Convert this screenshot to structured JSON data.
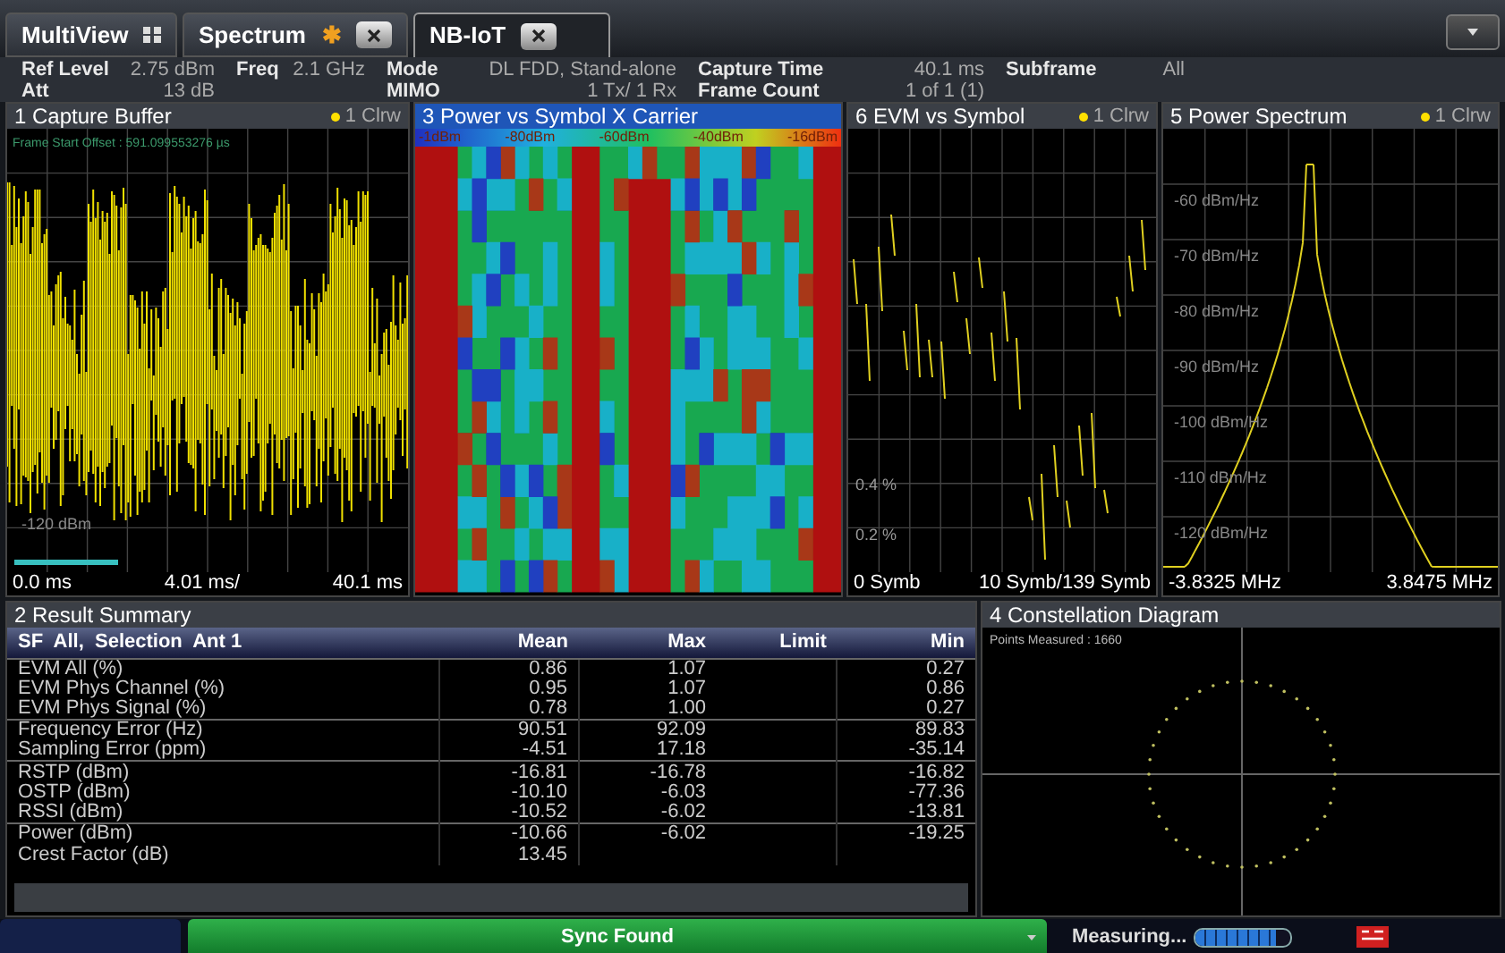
{
  "tabs": [
    {
      "label": "MultiView",
      "kind": "overview",
      "selected": false
    },
    {
      "label": "Spectrum",
      "kind": "closable",
      "selected": false,
      "modified": true,
      "mark": "✱"
    },
    {
      "label": "NB-IoT",
      "kind": "closable",
      "selected": true
    }
  ],
  "settings": [
    [
      {
        "label": "Ref Level",
        "value": "2.75 dBm"
      },
      {
        "label": "Att",
        "value": "13 dB"
      }
    ],
    [
      {
        "label": "Freq",
        "value": "2.1 GHz"
      }
    ],
    [
      {
        "label": "Mode",
        "value": "DL FDD, Stand-alone"
      },
      {
        "label": "MIMO",
        "value": "1 Tx/ 1 Rx"
      }
    ],
    [
      {
        "label": "Capture Time",
        "value": "40.1 ms"
      },
      {
        "label": "Frame Count",
        "value": "1 of 1 (1)"
      }
    ],
    [
      {
        "label": "Subframe",
        "value": "All"
      }
    ]
  ],
  "panels": [
    {
      "kind": "capture",
      "title": "1 Capture Buffer",
      "trace": "1 Clrw",
      "selected": false,
      "note": "Frame Start Offset : 591.099553276 µs",
      "y_labels": [
        "-120 dBm"
      ],
      "x_labels": [
        "0.0 ms",
        "4.01 ms/",
        "40.1 ms"
      ]
    },
    {
      "kind": "heatmap",
      "title": "3 Power vs Symbol X Carrier",
      "selected": true,
      "legend": [
        "-1dBm",
        "-80dBm",
        "-60dBm",
        "-40dBm",
        "-16dBm"
      ]
    },
    {
      "kind": "evm",
      "title": "6 EVM vs Symbol",
      "trace": "1 Clrw",
      "selected": false,
      "y_labels": [
        "0.4 %",
        "0.2 %"
      ],
      "x_labels": [
        "0 Symb",
        "10 Symb/139 Symb"
      ]
    },
    {
      "kind": "spectrum",
      "title": "5 Power Spectrum",
      "trace": "1 Clrw",
      "selected": false,
      "y_labels": [
        "-60 dBm/Hz",
        "-70 dBm/Hz",
        "-80 dBm/Hz",
        "-90 dBm/Hz",
        "-100 dBm/Hz",
        "-110 dBm/Hz",
        "-120 dBm/Hz"
      ],
      "x_labels": [
        "-3.8325 MHz",
        "3.8475 MHz"
      ]
    }
  ],
  "result_summary": {
    "title": "2 Result Summary",
    "columns": [
      "SF  All,  Selection  Ant 1",
      "Mean",
      "Max",
      "Limit",
      "Min"
    ],
    "groups": [
      [
        {
          "label": "EVM All (%)",
          "mean": "0.86",
          "max": "1.07",
          "min": "0.27"
        },
        {
          "label": "EVM Phys Channel (%)",
          "mean": "0.95",
          "max": "1.07",
          "min": "0.86"
        },
        {
          "label": "EVM Phys Signal (%)",
          "mean": "0.78",
          "max": "1.00",
          "min": "0.27"
        }
      ],
      [
        {
          "label": "Frequency Error (Hz)",
          "mean": "90.51",
          "max": "92.09",
          "min": "89.83"
        },
        {
          "label": "Sampling Error (ppm)",
          "mean": "-4.51",
          "max": "17.18",
          "min": "-35.14"
        }
      ],
      [
        {
          "label": "RSTP (dBm)",
          "mean": "-16.81",
          "max": "-16.78",
          "min": "-16.82"
        },
        {
          "label": "OSTP (dBm)",
          "mean": "-10.10",
          "max": "-6.03",
          "min": "-77.36"
        },
        {
          "label": "RSSI (dBm)",
          "mean": "-10.52",
          "max": "-6.02",
          "min": "-13.81"
        }
      ],
      [
        {
          "label": "Power (dBm)",
          "mean": "-10.66",
          "max": "-6.02",
          "min": "-19.25"
        },
        {
          "label": "Crest Factor (dB)",
          "mean": "13.45"
        }
      ]
    ]
  },
  "constellation": {
    "title": "4 Constellation Diagram",
    "note": "Points Measured : 1660"
  },
  "status_bar": {
    "sync": "Sync Found",
    "state": "Measuring...",
    "progress": {
      "level": 0.85
    }
  }
}
